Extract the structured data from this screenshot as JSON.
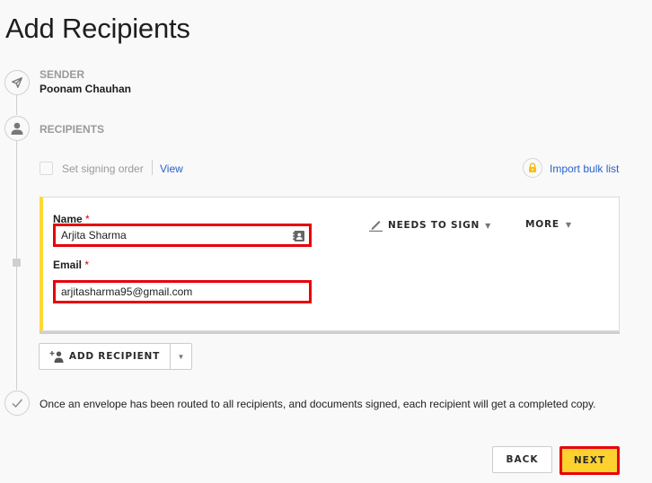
{
  "page": {
    "title": "Add Recipients"
  },
  "steps": {
    "sender": {
      "label": "SENDER",
      "name": "Poonam Chauhan",
      "icon": "send-icon"
    },
    "recipients": {
      "label": "RECIPIENTS",
      "icon": "person-icon"
    },
    "complete": {
      "icon": "check-icon",
      "text": "Once an envelope has been routed to all recipients, and documents signed, each recipient will get a completed copy."
    }
  },
  "signing_order": {
    "label": "Set signing order",
    "checked": false,
    "view_link": "View"
  },
  "import": {
    "label": "Import bulk list",
    "icon": "lock-icon"
  },
  "recipient_card": {
    "accent_color": "#fdd835",
    "name": {
      "label": "Name",
      "required_mark": "*",
      "value": "Arjita Sharma",
      "icon": "contact-card-icon"
    },
    "email": {
      "label": "Email",
      "required_mark": "*",
      "value": "arjitasharma95@gmail.com"
    },
    "action": {
      "label": "NEEDS TO SIGN",
      "icon": "pen-icon"
    },
    "more": {
      "label": "MORE"
    }
  },
  "add_recipient": {
    "label": "ADD RECIPIENT",
    "icon": "add-person-icon"
  },
  "footer": {
    "back_label": "BACK",
    "next_label": "NEXT"
  },
  "colors": {
    "link": "#2a62c9",
    "highlight": "#e8000b",
    "primary": "#fdd22e",
    "required": "#d0021b"
  }
}
